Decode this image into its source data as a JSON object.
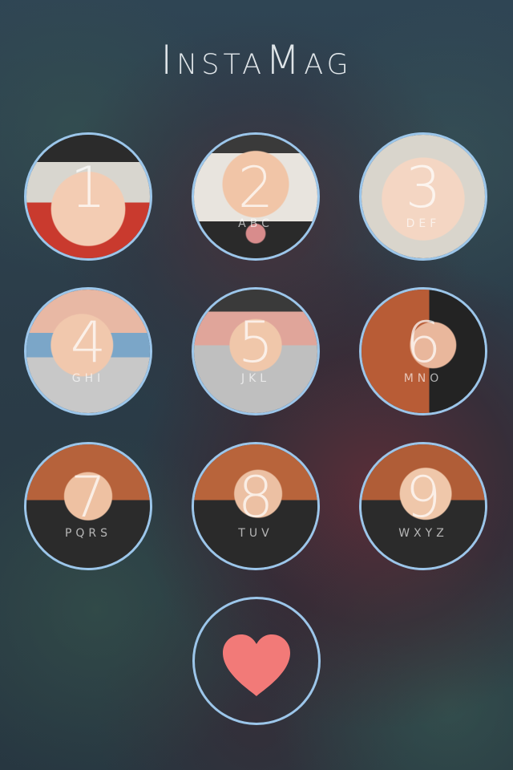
{
  "app": {
    "title": "InstaMag"
  },
  "keypad": {
    "keys": [
      {
        "digit": "1",
        "letters": ""
      },
      {
        "digit": "2",
        "letters": "ABC"
      },
      {
        "digit": "3",
        "letters": "DEF"
      },
      {
        "digit": "4",
        "letters": "GHI"
      },
      {
        "digit": "5",
        "letters": "JKL"
      },
      {
        "digit": "6",
        "letters": "MNO"
      },
      {
        "digit": "7",
        "letters": "PQRS"
      },
      {
        "digit": "8",
        "letters": "TUV"
      },
      {
        "digit": "9",
        "letters": "WXYZ"
      }
    ],
    "action_icon": "heart-icon"
  },
  "colors": {
    "ring": "#9cc6ea",
    "heart": "#f27a78"
  }
}
